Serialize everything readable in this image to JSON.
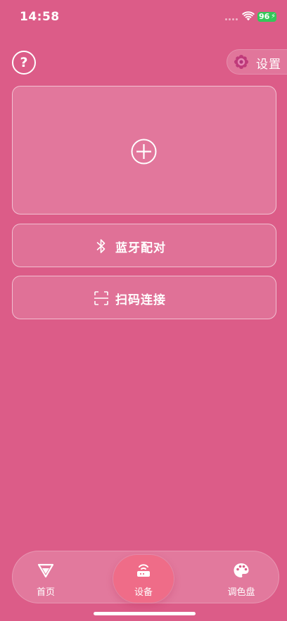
{
  "status_bar": {
    "time": "14:58",
    "battery": "96"
  },
  "header": {
    "help_label": "?",
    "settings_label": "设置"
  },
  "main": {
    "add_device_icon": "plus-circle-icon",
    "bluetooth_label": "蓝牙配对",
    "scan_label": "扫码连接"
  },
  "tabs": [
    {
      "label": "首页",
      "icon": "home-logo-icon",
      "selected": false
    },
    {
      "label": "设备",
      "icon": "router-icon",
      "selected": true
    },
    {
      "label": "调色盘",
      "icon": "palette-icon",
      "selected": false
    }
  ],
  "colors": {
    "background": "#dc5c88",
    "active_tab": "#ef6c88",
    "battery": "#35c759"
  }
}
